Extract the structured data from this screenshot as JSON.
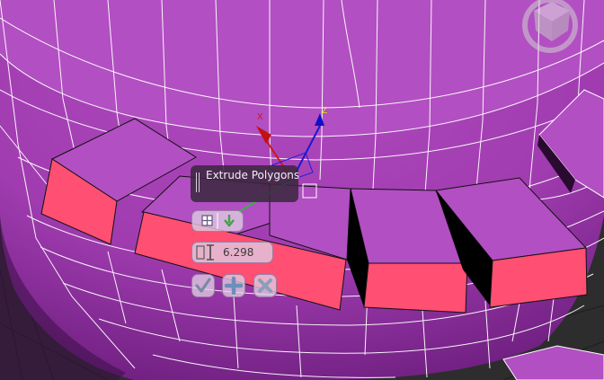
{
  "caddy": {
    "title": "Extrude Polygons",
    "amount_value": "6.298"
  },
  "gizmo": {
    "x_axis_label": "X",
    "z_axis_label": "Z"
  },
  "colors": {
    "mesh": "#a63fb5",
    "mesh_light": "#b24fc2",
    "selected_face": "#ff4f73",
    "wire": "#ffffff",
    "caddy_title_bg": "#3a283e",
    "caddy_button_bg": "#e1cde4"
  },
  "icons": {
    "handle": "grip-icon",
    "mode": "extrude-group-icon",
    "amount": "extrude-height-icon",
    "ok": "checkmark-icon",
    "apply": "plus-icon",
    "cancel": "x-icon",
    "view_cube": "viewcube-icon"
  }
}
